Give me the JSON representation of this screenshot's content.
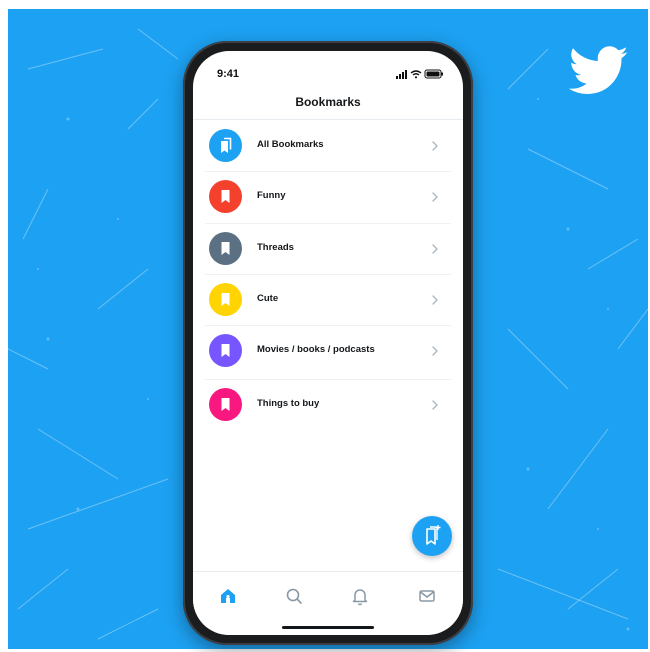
{
  "status_bar": {
    "time": "9:41"
  },
  "header": {
    "title": "Bookmarks"
  },
  "bookmarks": [
    {
      "label": "All Bookmarks",
      "color": "#1da1f2",
      "icon": "bookmarks-stack-icon"
    },
    {
      "label": "Funny",
      "color": "#f4412d",
      "icon": "bookmark-icon"
    },
    {
      "label": "Threads",
      "color": "#5b7083",
      "icon": "bookmark-icon"
    },
    {
      "label": "Cute",
      "color": "#ffd400",
      "icon": "bookmark-icon"
    },
    {
      "label": "Movies / books / podcasts",
      "color": "#7856ff",
      "icon": "bookmark-icon"
    },
    {
      "label": "Things to buy",
      "color": "#f91880",
      "icon": "bookmark-icon"
    }
  ],
  "fab": {
    "icon": "new-bookmark-folder-icon",
    "color": "#1da1f2"
  },
  "tab_bar": [
    {
      "name": "home",
      "icon": "home-icon",
      "active": true
    },
    {
      "name": "search",
      "icon": "search-icon",
      "active": false
    },
    {
      "name": "notifications",
      "icon": "bell-icon",
      "active": false
    },
    {
      "name": "messages",
      "icon": "mail-icon",
      "active": false
    }
  ],
  "colors": {
    "brand": "#1da1f2",
    "text": "#14171a",
    "icon_gray": "#8899a6"
  },
  "brand_logo": "twitter-bird-logo"
}
